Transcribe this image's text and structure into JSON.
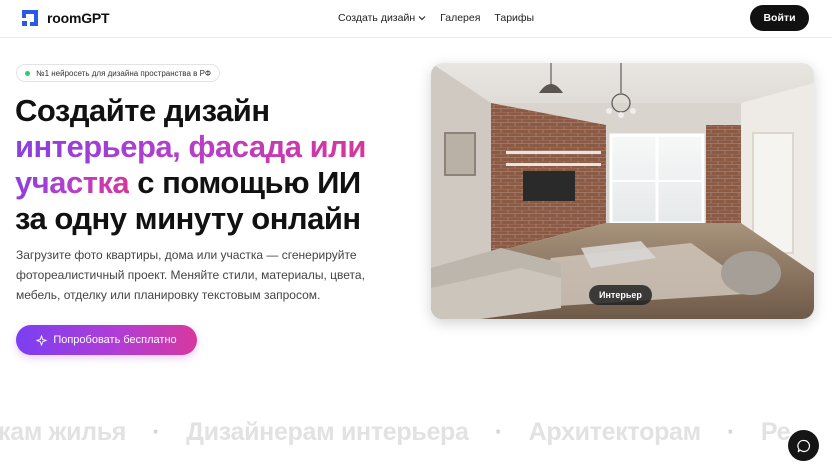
{
  "header": {
    "brand": "roomGPT",
    "nav": [
      {
        "label": "Создать дизайн",
        "has_dropdown": true
      },
      {
        "label": "Галерея"
      },
      {
        "label": "Тарифы"
      }
    ],
    "login_label": "Войти"
  },
  "hero": {
    "badge": "№1 нейросеть для дизайна пространства в РФ",
    "headline": {
      "line1": "Создайте дизайн",
      "line2_gradient": "интерьера, фасада или",
      "line3_gradient": "участка",
      "line3_rest": " с помощью ИИ",
      "line4": "за одну минуту онлайн"
    },
    "description": "Загрузите фото квартиры, дома или участка — сгенерируйте фотореалистичный проект. Меняйте стили, материалы, цвета, мебель, отделку или планировку текстовым запросом.",
    "cta_label": "Попробовать бесплатно",
    "cta_icon": "sparkle-icon"
  },
  "preview": {
    "label": "Интерьер"
  },
  "marquee": {
    "items": [
      "кам жилья",
      "Дизайнерам интерьера",
      "Архитекторам",
      "Ре"
    ],
    "separator": "·"
  },
  "colors": {
    "accent_start": "#7b3ff2",
    "accent_end": "#d8389f",
    "dark": "#111111"
  },
  "icons": {
    "logo": "logo-icon",
    "dropdown": "chevron-down-icon",
    "chat": "chat-bubble-icon"
  }
}
